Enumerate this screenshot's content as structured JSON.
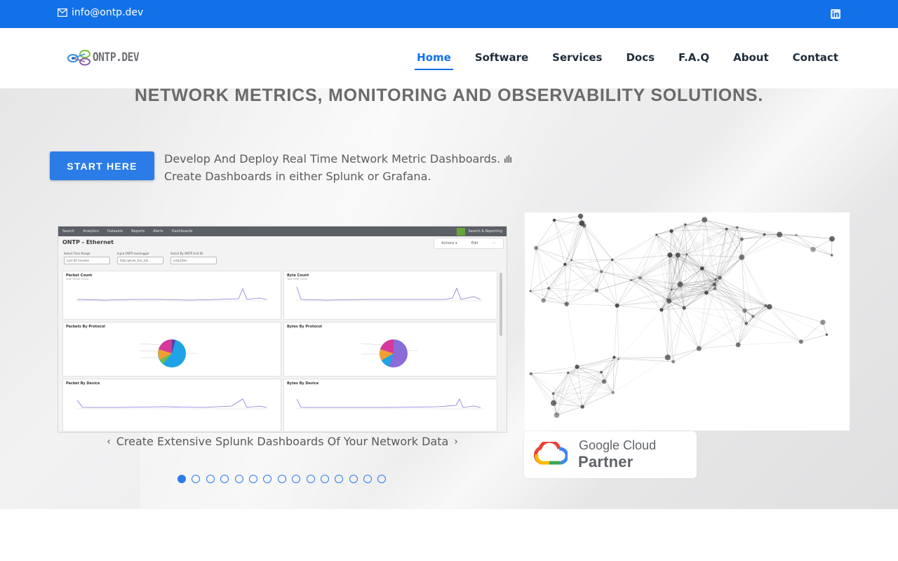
{
  "topbar": {
    "email": "info@ontp.dev",
    "email_icon": "envelope-icon",
    "social_icon": "linkedin-icon",
    "bg_color": "#1271e8"
  },
  "header": {
    "logo_text": "ONTP.DEV",
    "nav": [
      {
        "label": "Home",
        "active": true
      },
      {
        "label": "Software",
        "active": false
      },
      {
        "label": "Services",
        "active": false
      },
      {
        "label": "Docs",
        "active": false
      },
      {
        "label": "F.A.Q",
        "active": false
      },
      {
        "label": "About",
        "active": false
      },
      {
        "label": "Contact",
        "active": false
      }
    ],
    "accent_color": "#1271e8"
  },
  "hero": {
    "title": "NETWORK METRICS, MONITORING AND OBSERVABILITY SOLUTIONS.",
    "cta_label": "START HERE",
    "tagline_line1": "Develop And Deploy Real Time Network Metric Dashboards.",
    "tagline_line2": "Create Dashboards in either Splunk or Grafana.",
    "tagline_icon": "bar-chart-icon",
    "slider": {
      "caption": "Create Extensive Splunk Dashboards Of Your Network Data",
      "prev_icon": "chevron-left-icon",
      "next_icon": "chevron-right-icon",
      "total_slides": 15,
      "active_index": 0
    },
    "dashboard": {
      "tabs": [
        "Search",
        "Analytics",
        "Datasets",
        "Reports",
        "Alerts",
        "Dashboards"
      ],
      "app_name": "Search & Reporting",
      "title": "ONTP - Ethernet",
      "tools": [
        "Actions ▾",
        "Edit",
        "⋯"
      ],
      "filters": [
        {
          "label": "Select Time Range",
          "value": "Last 60 minutes"
        },
        {
          "label": "Input ONTP execlogger",
          "value": "http:splunk_hec_tok..."
        },
        {
          "label": "Select By ONTP Unit ID",
          "value": "ontp1Dev"
        }
      ],
      "panels": [
        {
          "title": "Packet Count",
          "subtitle": "Total Packet Count"
        },
        {
          "title": "Byte Count",
          "subtitle": "Total Byte Count"
        },
        {
          "title": "Packets By Protocol",
          "subtitle": ""
        },
        {
          "title": "Bytes By Protocol",
          "subtitle": ""
        },
        {
          "title": "Packet By Device",
          "subtitle": ""
        },
        {
          "title": "Bytes By Device",
          "subtitle": ""
        }
      ]
    },
    "partner": {
      "name": "Google Cloud",
      "label": "Partner",
      "icon": "google-cloud-icon"
    }
  }
}
